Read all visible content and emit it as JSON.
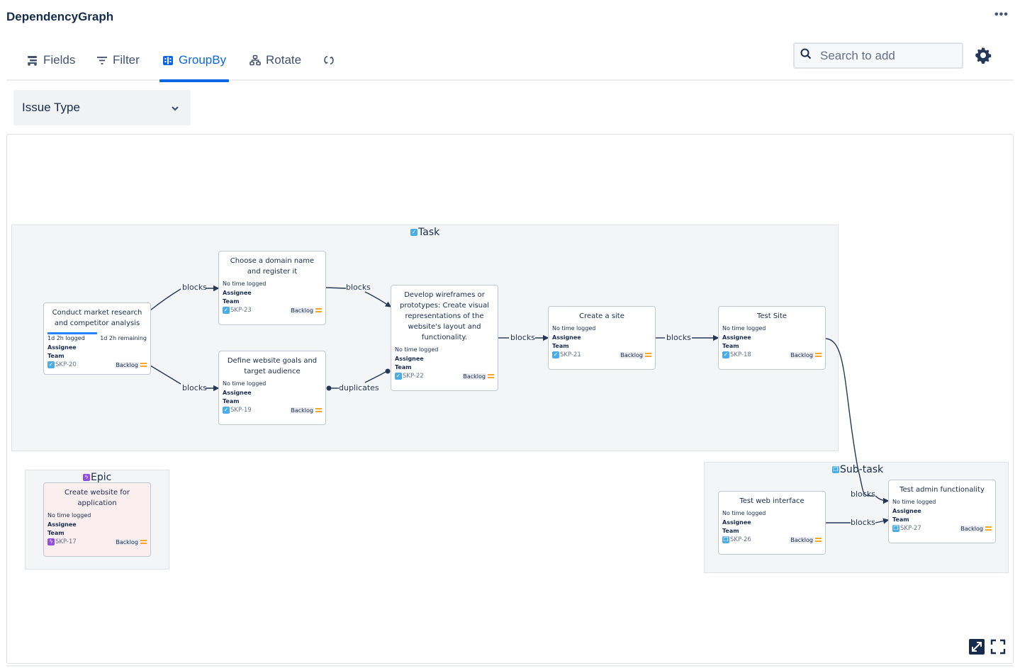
{
  "app": {
    "title": "DependencyGraph",
    "more_label": "•••"
  },
  "toolbar": {
    "tabs": [
      {
        "label": "Fields",
        "icon": "fields-icon",
        "active": false
      },
      {
        "label": "Filter",
        "icon": "filter-icon",
        "active": false
      },
      {
        "label": "GroupBy",
        "icon": "groupby-icon",
        "active": true
      },
      {
        "label": "Rotate",
        "icon": "rotate-icon",
        "active": false
      },
      {
        "label": "",
        "icon": "refresh-icon",
        "active": false
      }
    ],
    "search": {
      "placeholder": "Search to add",
      "value": ""
    },
    "settings_icon": "gear-icon"
  },
  "groupby_select": {
    "value": "Issue Type"
  },
  "graph": {
    "groups": [
      {
        "name": "Task",
        "icon": "task"
      },
      {
        "name": "Epic",
        "icon": "epic"
      },
      {
        "name": "Sub-task",
        "icon": "subtask"
      }
    ],
    "nodes": [
      {
        "key": "SKP-20",
        "title": "Conduct market research and competitor analysis",
        "time": "",
        "logged": "1d 2h logged",
        "remaining": "1d 2h remaining",
        "progress_pct": 50,
        "assignee": "Assignee",
        "team": "Team",
        "status": "Backlog",
        "type": "task"
      },
      {
        "key": "SKP-23",
        "title": "Choose a domain name and register it",
        "time": "No time logged",
        "assignee": "Assignee",
        "team": "Team",
        "status": "Backlog",
        "type": "task"
      },
      {
        "key": "SKP-19",
        "title": "Define website goals and target audience",
        "time": "No time logged",
        "assignee": "Assignee",
        "team": "Team",
        "status": "Backlog",
        "type": "task"
      },
      {
        "key": "SKP-22",
        "title": "Develop wireframes or prototypes: Create visual representations of the website's layout and functionality.",
        "time": "No time logged",
        "assignee": "Assignee",
        "team": "Team",
        "status": "Backlog",
        "type": "task"
      },
      {
        "key": "SKP-21",
        "title": "Create a site",
        "time": "No time logged",
        "assignee": "Assignee",
        "team": "Team",
        "status": "Backlog",
        "type": "task"
      },
      {
        "key": "SKP-18",
        "title": "Test Site",
        "time": "No time logged",
        "assignee": "Assignee",
        "team": "Team",
        "status": "Backlog",
        "type": "task"
      },
      {
        "key": "SKP-17",
        "title": "Create website for application",
        "time": "No time logged",
        "assignee": "Assignee",
        "team": "Team",
        "status": "Backlog",
        "type": "epic"
      },
      {
        "key": "SKP-26",
        "title": "Test web interface",
        "time": "No time logged",
        "assignee": "Assignee",
        "team": "Team",
        "status": "Backlog",
        "type": "subtask"
      },
      {
        "key": "SKP-27",
        "title": "Test admin functionality",
        "time": "No time logged",
        "assignee": "Assignee",
        "team": "Team",
        "status": "Backlog",
        "type": "subtask"
      }
    ],
    "edges": [
      {
        "from": "SKP-20",
        "to": "SKP-23",
        "label": "blocks"
      },
      {
        "from": "SKP-20",
        "to": "SKP-19",
        "label": "blocks"
      },
      {
        "from": "SKP-23",
        "to": "SKP-22",
        "label": "blocks"
      },
      {
        "from": "SKP-19",
        "to": "SKP-22",
        "label": "duplicates"
      },
      {
        "from": "SKP-22",
        "to": "SKP-21",
        "label": "blocks"
      },
      {
        "from": "SKP-21",
        "to": "SKP-18",
        "label": "blocks"
      },
      {
        "from": "SKP-18",
        "to": "SKP-27",
        "label": "blocks"
      },
      {
        "from": "SKP-26",
        "to": "SKP-27",
        "label": "blocks"
      }
    ]
  },
  "colors": {
    "accent": "#0c66e4",
    "task_icon": "#4bade8",
    "epic_icon": "#904ee2",
    "status_marker": "#f5a623",
    "edge": "#253858"
  },
  "corner_controls": [
    {
      "name": "fit-to-view"
    },
    {
      "name": "fullscreen"
    }
  ]
}
